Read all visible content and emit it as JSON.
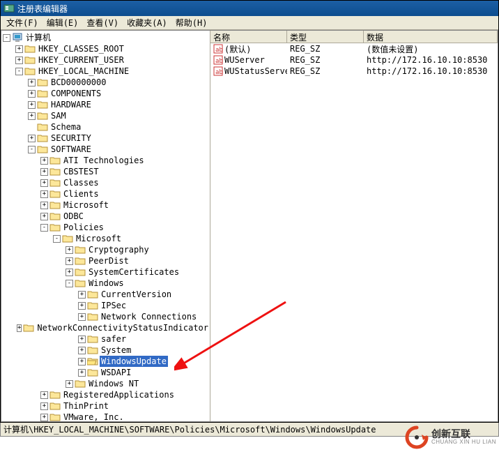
{
  "titlebar": {
    "title": "注册表编辑器"
  },
  "menubar": {
    "file": "文件(F)",
    "edit": "编辑(E)",
    "view": "查看(V)",
    "favorites": "收藏夹(A)",
    "help": "帮助(H)"
  },
  "list": {
    "columns": {
      "name": "名称",
      "type": "类型",
      "data": "数据"
    },
    "rows": [
      {
        "icon": "string-value-icon",
        "name": "(默认)",
        "type": "REG_SZ",
        "data": "(数值未设置)"
      },
      {
        "icon": "string-value-icon",
        "name": "WUServer",
        "type": "REG_SZ",
        "data": "http://172.16.10.10:8530"
      },
      {
        "icon": "string-value-icon",
        "name": "WUStatusServer",
        "type": "REG_SZ",
        "data": "http://172.16.10.10:8530"
      }
    ]
  },
  "tree": [
    {
      "depth": 0,
      "toggle": "-",
      "icon": "computer",
      "label": "计算机"
    },
    {
      "depth": 1,
      "toggle": "+",
      "icon": "folder",
      "label": "HKEY_CLASSES_ROOT"
    },
    {
      "depth": 1,
      "toggle": "+",
      "icon": "folder",
      "label": "HKEY_CURRENT_USER"
    },
    {
      "depth": 1,
      "toggle": "-",
      "icon": "folder",
      "label": "HKEY_LOCAL_MACHINE"
    },
    {
      "depth": 2,
      "toggle": "+",
      "icon": "folder",
      "label": "BCD00000000"
    },
    {
      "depth": 2,
      "toggle": "+",
      "icon": "folder",
      "label": "COMPONENTS"
    },
    {
      "depth": 2,
      "toggle": "+",
      "icon": "folder",
      "label": "HARDWARE"
    },
    {
      "depth": 2,
      "toggle": "+",
      "icon": "folder",
      "label": "SAM"
    },
    {
      "depth": 2,
      "toggle": "",
      "icon": "folder",
      "label": "Schema"
    },
    {
      "depth": 2,
      "toggle": "+",
      "icon": "folder",
      "label": "SECURITY"
    },
    {
      "depth": 2,
      "toggle": "-",
      "icon": "folder",
      "label": "SOFTWARE"
    },
    {
      "depth": 3,
      "toggle": "+",
      "icon": "folder",
      "label": "ATI Technologies"
    },
    {
      "depth": 3,
      "toggle": "+",
      "icon": "folder",
      "label": "CBSTEST"
    },
    {
      "depth": 3,
      "toggle": "+",
      "icon": "folder",
      "label": "Classes"
    },
    {
      "depth": 3,
      "toggle": "+",
      "icon": "folder",
      "label": "Clients"
    },
    {
      "depth": 3,
      "toggle": "+",
      "icon": "folder",
      "label": "Microsoft"
    },
    {
      "depth": 3,
      "toggle": "+",
      "icon": "folder",
      "label": "ODBC"
    },
    {
      "depth": 3,
      "toggle": "-",
      "icon": "folder",
      "label": "Policies"
    },
    {
      "depth": 4,
      "toggle": "-",
      "icon": "folder",
      "label": "Microsoft"
    },
    {
      "depth": 5,
      "toggle": "+",
      "icon": "folder",
      "label": "Cryptography"
    },
    {
      "depth": 5,
      "toggle": "+",
      "icon": "folder",
      "label": "PeerDist"
    },
    {
      "depth": 5,
      "toggle": "+",
      "icon": "folder",
      "label": "SystemCertificates"
    },
    {
      "depth": 5,
      "toggle": "-",
      "icon": "folder",
      "label": "Windows"
    },
    {
      "depth": 6,
      "toggle": "+",
      "icon": "folder",
      "label": "CurrentVersion"
    },
    {
      "depth": 6,
      "toggle": "+",
      "icon": "folder",
      "label": "IPSec"
    },
    {
      "depth": 6,
      "toggle": "+",
      "icon": "folder",
      "label": "Network Connections"
    },
    {
      "depth": 6,
      "toggle": "+",
      "icon": "folder",
      "label": "NetworkConnectivityStatusIndicator"
    },
    {
      "depth": 6,
      "toggle": "+",
      "icon": "folder",
      "label": "safer"
    },
    {
      "depth": 6,
      "toggle": "+",
      "icon": "folder",
      "label": "System"
    },
    {
      "depth": 6,
      "toggle": "+",
      "icon": "folder-open",
      "label": "WindowsUpdate",
      "selected": true
    },
    {
      "depth": 6,
      "toggle": "+",
      "icon": "folder",
      "label": "WSDAPI"
    },
    {
      "depth": 5,
      "toggle": "+",
      "icon": "folder",
      "label": "Windows NT"
    },
    {
      "depth": 3,
      "toggle": "+",
      "icon": "folder",
      "label": "RegisteredApplications"
    },
    {
      "depth": 3,
      "toggle": "+",
      "icon": "folder",
      "label": "ThinPrint"
    },
    {
      "depth": 3,
      "toggle": "+",
      "icon": "folder",
      "label": "VMware, Inc."
    }
  ],
  "statusbar": {
    "path": "计算机\\HKEY_LOCAL_MACHINE\\SOFTWARE\\Policies\\Microsoft\\Windows\\WindowsUpdate"
  },
  "watermark": {
    "cn": "创新互联",
    "en": "CHUANG XIN HU LIAN"
  }
}
